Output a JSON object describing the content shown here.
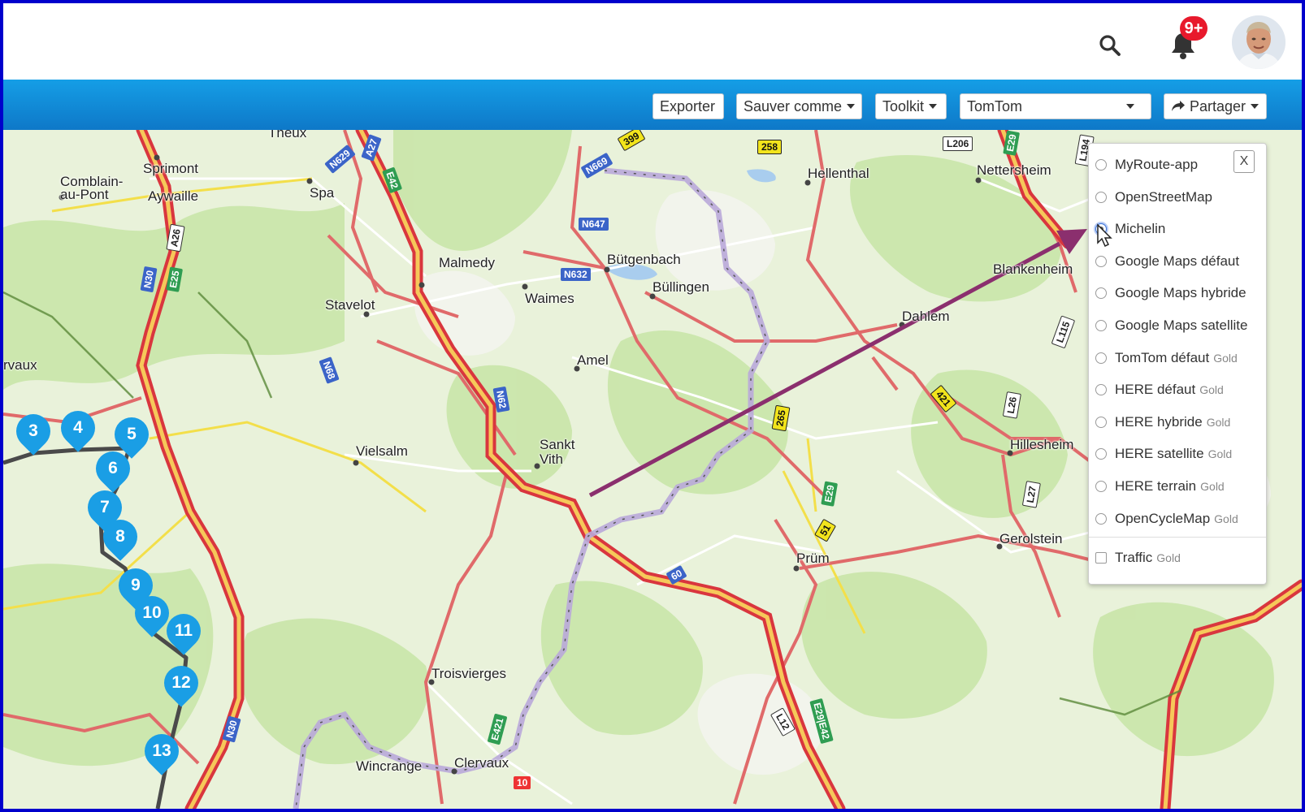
{
  "header": {
    "notification_badge": "9+",
    "icons": {
      "search": "search-icon",
      "notifications": "bell-icon",
      "avatar": "user-avatar"
    }
  },
  "toolbar": {
    "export_label": "Exporter",
    "save_as_label": "Sauver comme",
    "toolkit_label": "Toolkit",
    "map_provider_selected": "TomTom",
    "share_label": "Partager"
  },
  "layer_menu": {
    "close_label": "X",
    "gold_label": "Gold",
    "options": [
      {
        "label": "MyRoute-app",
        "gold": false,
        "selected": false
      },
      {
        "label": "OpenStreetMap",
        "gold": false,
        "selected": false
      },
      {
        "label": "Michelin",
        "gold": false,
        "selected": true
      },
      {
        "label": "Google Maps défaut",
        "gold": false,
        "selected": false
      },
      {
        "label": "Google Maps hybride",
        "gold": false,
        "selected": false
      },
      {
        "label": "Google Maps satellite",
        "gold": false,
        "selected": false
      },
      {
        "label": "TomTom défaut",
        "gold": true,
        "selected": false
      },
      {
        "label": "HERE défaut",
        "gold": true,
        "selected": false
      },
      {
        "label": "HERE hybride",
        "gold": true,
        "selected": false
      },
      {
        "label": "HERE satellite",
        "gold": true,
        "selected": false
      },
      {
        "label": "HERE terrain",
        "gold": true,
        "selected": false
      },
      {
        "label": "OpenCycleMap",
        "gold": true,
        "selected": false
      }
    ],
    "traffic": {
      "label": "Traffic",
      "gold": true,
      "checked": false
    }
  },
  "map": {
    "places": [
      "Theux",
      "Sprimont",
      "Comblain-",
      "au-Pont",
      "Aywaille",
      "Spa",
      "Malmedy",
      "Waimes",
      "Bütgenbach",
      "Büllingen",
      "Stavelot",
      "Hellenthal",
      "Nettersheim",
      "Blankenheim",
      "Dahlem",
      "Amel",
      "rvaux",
      "Vielsalm",
      "Sankt",
      "Vith",
      "Hillesheim",
      "Gerolstein",
      "Prüm",
      "Troisvierges",
      "Clervaux",
      "Wincrange"
    ],
    "roads": [
      "A27",
      "N629",
      "E42",
      "N669",
      "399",
      "258",
      "L206",
      "E29",
      "L194",
      "N647",
      "N632",
      "A26",
      "N30",
      "E25",
      "N68",
      "N62",
      "265",
      "421",
      "L115",
      "L26",
      "L27",
      "E29",
      "51",
      "60",
      "E421",
      "L12",
      "E29|E42",
      "N30",
      "10"
    ],
    "markers": [
      "3",
      "4",
      "5",
      "6",
      "7",
      "8",
      "9",
      "10",
      "11",
      "12",
      "13"
    ]
  },
  "colors": {
    "toolbar": "#159ee6",
    "marker": "#1a9ee5",
    "badge": "#e8192c",
    "arrow": "#8b2f6e",
    "frame": "#0000cc"
  }
}
